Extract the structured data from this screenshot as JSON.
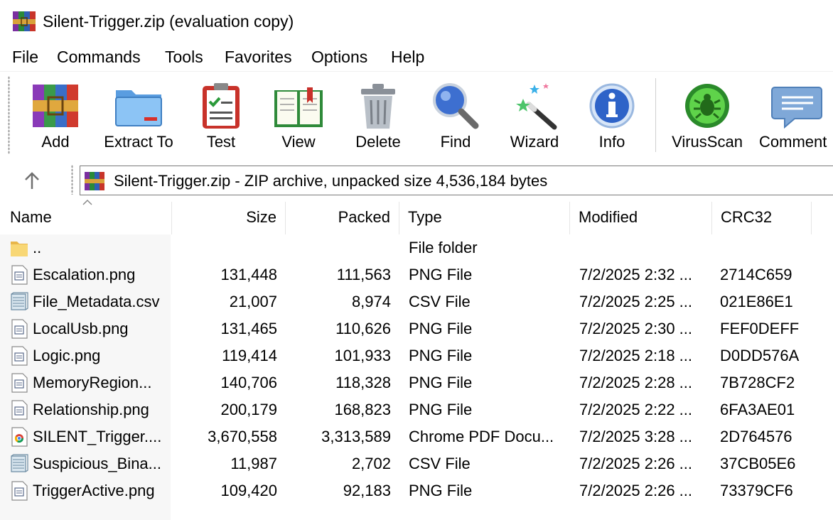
{
  "window": {
    "title": "Silent-Trigger.zip (evaluation copy)"
  },
  "menu": [
    "File",
    "Commands",
    "Tools",
    "Favorites",
    "Options",
    "Help"
  ],
  "toolbar": {
    "buttons": [
      {
        "label": "Add",
        "icon": "add-archive-icon"
      },
      {
        "label": "Extract To",
        "icon": "extract-folder-icon"
      },
      {
        "label": "Test",
        "icon": "test-clipboard-icon"
      },
      {
        "label": "View",
        "icon": "view-book-icon"
      },
      {
        "label": "Delete",
        "icon": "trash-icon"
      },
      {
        "label": "Find",
        "icon": "magnifier-icon"
      },
      {
        "label": "Wizard",
        "icon": "magic-wand-icon"
      },
      {
        "label": "Info",
        "icon": "info-icon"
      },
      {
        "label": "VirusScan",
        "icon": "virus-scan-icon"
      },
      {
        "label": "Comment",
        "icon": "comment-icon"
      }
    ]
  },
  "address": {
    "text": "Silent-Trigger.zip - ZIP archive, unpacked size 4,536,184 bytes"
  },
  "columns": {
    "name": "Name",
    "size": "Size",
    "packed": "Packed",
    "type": "Type",
    "modified": "Modified",
    "crc": "CRC32"
  },
  "files": [
    {
      "name": "..",
      "size": "",
      "packed": "",
      "type": "File folder",
      "modified": "",
      "crc": "",
      "icon": "folder-icon"
    },
    {
      "name": "Escalation.png",
      "size": "131,448",
      "packed": "111,563",
      "type": "PNG File",
      "modified": "7/2/2025 2:32 ...",
      "crc": "2714C659",
      "icon": "image-file-icon"
    },
    {
      "name": "File_Metadata.csv",
      "size": "21,007",
      "packed": "8,974",
      "type": "CSV File",
      "modified": "7/2/2025 2:25 ...",
      "crc": "021E86E1",
      "icon": "csv-file-icon"
    },
    {
      "name": "LocalUsb.png",
      "size": "131,465",
      "packed": "110,626",
      "type": "PNG File",
      "modified": "7/2/2025 2:30 ...",
      "crc": "FEF0DEFF",
      "icon": "image-file-icon"
    },
    {
      "name": "Logic.png",
      "size": "119,414",
      "packed": "101,933",
      "type": "PNG File",
      "modified": "7/2/2025 2:18 ...",
      "crc": "D0DD576A",
      "icon": "image-file-icon"
    },
    {
      "name": "MemoryRegion...",
      "size": "140,706",
      "packed": "118,328",
      "type": "PNG File",
      "modified": "7/2/2025 2:28 ...",
      "crc": "7B728CF2",
      "icon": "image-file-icon"
    },
    {
      "name": "Relationship.png",
      "size": "200,179",
      "packed": "168,823",
      "type": "PNG File",
      "modified": "7/2/2025 2:22 ...",
      "crc": "6FA3AE01",
      "icon": "image-file-icon"
    },
    {
      "name": "SILENT_Trigger....",
      "size": "3,670,558",
      "packed": "3,313,589",
      "type": "Chrome PDF Docu...",
      "modified": "7/2/2025 3:28 ...",
      "crc": "2D764576",
      "icon": "chrome-pdf-icon"
    },
    {
      "name": "Suspicious_Bina...",
      "size": "11,987",
      "packed": "2,702",
      "type": "CSV File",
      "modified": "7/2/2025 2:26 ...",
      "crc": "37CB05E6",
      "icon": "csv-file-icon"
    },
    {
      "name": "TriggerActive.png",
      "size": "109,420",
      "packed": "92,183",
      "type": "PNG File",
      "modified": "7/2/2025 2:26 ...",
      "crc": "73379CF6",
      "icon": "image-file-icon"
    }
  ]
}
